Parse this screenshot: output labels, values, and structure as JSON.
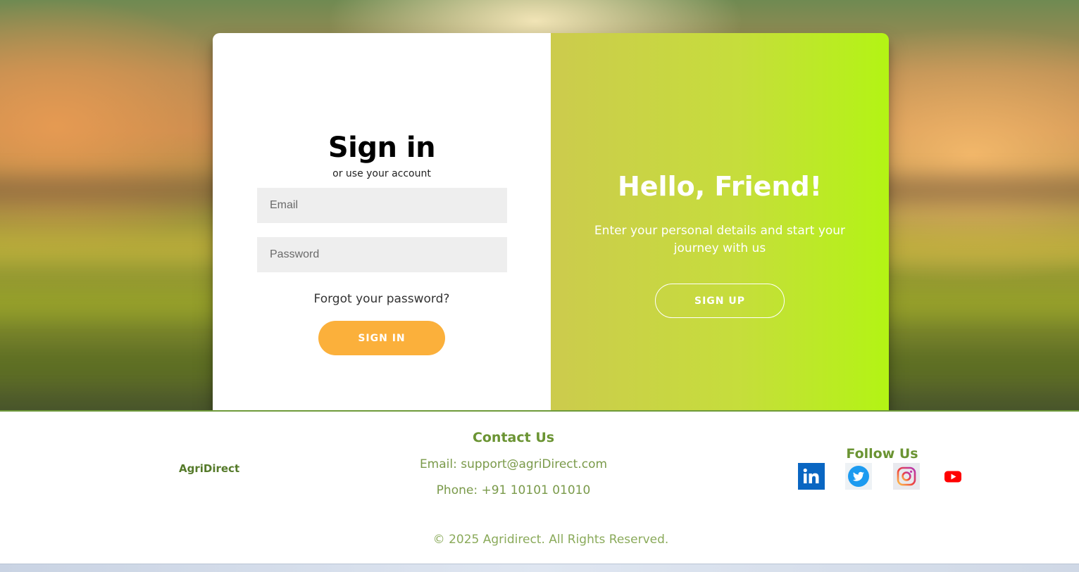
{
  "signin": {
    "title": "Sign in",
    "subtitle": "or use your account",
    "email_placeholder": "Email",
    "password_placeholder": "Password",
    "forgot_label": "Forgot your password?",
    "button_label": "SIGN IN"
  },
  "overlay": {
    "title": "Hello, Friend!",
    "text": "Enter your personal details and start your journey with us",
    "button_label": "SIGN UP"
  },
  "footer": {
    "brand": "AgriDirect",
    "contact": {
      "title": "Contact Us",
      "email": "Email: support@agriDirect.com",
      "phone": "Phone: +91 10101 01010"
    },
    "follow": {
      "title": "Follow Us",
      "icons": [
        "linkedin-icon",
        "twitter-icon",
        "instagram-icon",
        "youtube-icon"
      ]
    },
    "copyright": "© 2025 Agridirect. All Rights Reserved."
  },
  "colors": {
    "signin_button": "#fbb03b",
    "overlay_gradient_start": "#cccb4d",
    "overlay_gradient_end": "#b3f414",
    "footer_heading": "#6b9433",
    "footer_text": "#7a9a4a"
  }
}
